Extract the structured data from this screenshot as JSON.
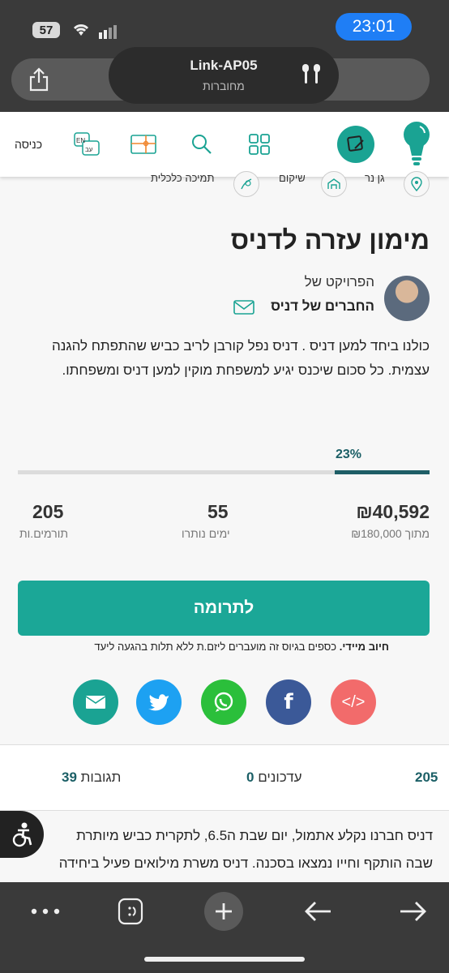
{
  "status": {
    "battery": "57",
    "time": "23:01"
  },
  "airpods": {
    "title": "Link-AP05",
    "subtitle": "מחוברות"
  },
  "header": {
    "login": "כניסה",
    "lang_en": "EN",
    "lang_he": "עב"
  },
  "categories": [
    "גן נר",
    "שיקום",
    "תמיכה כלכלית"
  ],
  "project": {
    "title": "מימון עזרה לדניס",
    "project_of": "הפרויקט של",
    "owner": "החברים של דניס",
    "description": "כולנו ביחד למען דניס . דניס נפל קורבן לריב כביש שהתפתח להגנה עצמית. כל סכום שיכנס יגיע למשפחת מוקין למען דניס ומשפחתו."
  },
  "progress": {
    "percent_label": "23%",
    "fraction": 0.23
  },
  "stats": {
    "raised": "₪40,592",
    "goal": "מתוך ₪180,000",
    "days": "55",
    "days_label": "ימים נותרו",
    "donors": "205",
    "donors_label": "תורמים.ות"
  },
  "donate": {
    "button": "לתרומה",
    "commit_bold": "חיוב מיידי.",
    "commit_text": " כספים בגיוס זה מועברים ליזם.ת ללא תלות בהגעה ליעד"
  },
  "share": {
    "embed": "</>",
    "facebook": "f",
    "colors": {
      "embed": "#f26b6b",
      "facebook": "#3b5998",
      "whatsapp": "#2bbf3b",
      "twitter": "#1da1f2",
      "email": "#1aa393"
    }
  },
  "tabs": {
    "donors_count": "205",
    "updates_label": "עדכונים",
    "updates_count": "0",
    "comments_label": "תגובות",
    "comments_count": "39"
  },
  "story": {
    "line1": "דניס חברנו נקלע אתמול, יום שבת ה6.5, לתקרית כביש מיותרת",
    "line2": "שבה הותקף וחייו נמצאו בסכנה. דניס משרת מילואים פעיל ביחידה"
  },
  "colors": {
    "accent": "#1ba797",
    "progress": "#1e5e66",
    "time_pill": "#1f7ef5"
  }
}
